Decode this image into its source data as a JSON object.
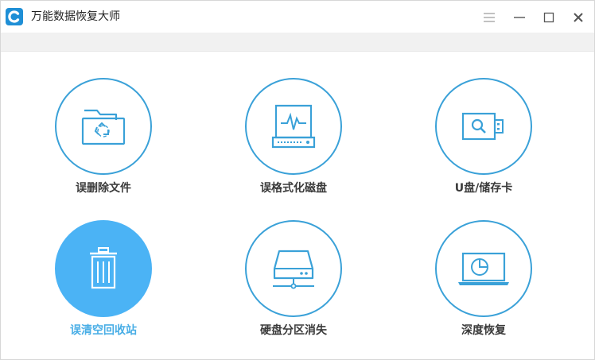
{
  "window": {
    "title": "万能数据恢复大师"
  },
  "colors": {
    "accent": "#3aa1d8",
    "active_fill": "#4bb3f5",
    "active_label": "#49aee6"
  },
  "tiles": [
    {
      "label": "误删除文件",
      "icon": "folder-recycle-icon",
      "active": false
    },
    {
      "label": "误格式化磁盘",
      "icon": "disk-waveform-icon",
      "active": false
    },
    {
      "label": "U盘/储存卡",
      "icon": "usb-drive-icon",
      "active": false
    },
    {
      "label": "误清空回收站",
      "icon": "trash-bin-icon",
      "active": true
    },
    {
      "label": "硬盘分区消失",
      "icon": "hard-drive-network-icon",
      "active": false
    },
    {
      "label": "深度恢复",
      "icon": "laptop-scan-icon",
      "active": false
    }
  ]
}
